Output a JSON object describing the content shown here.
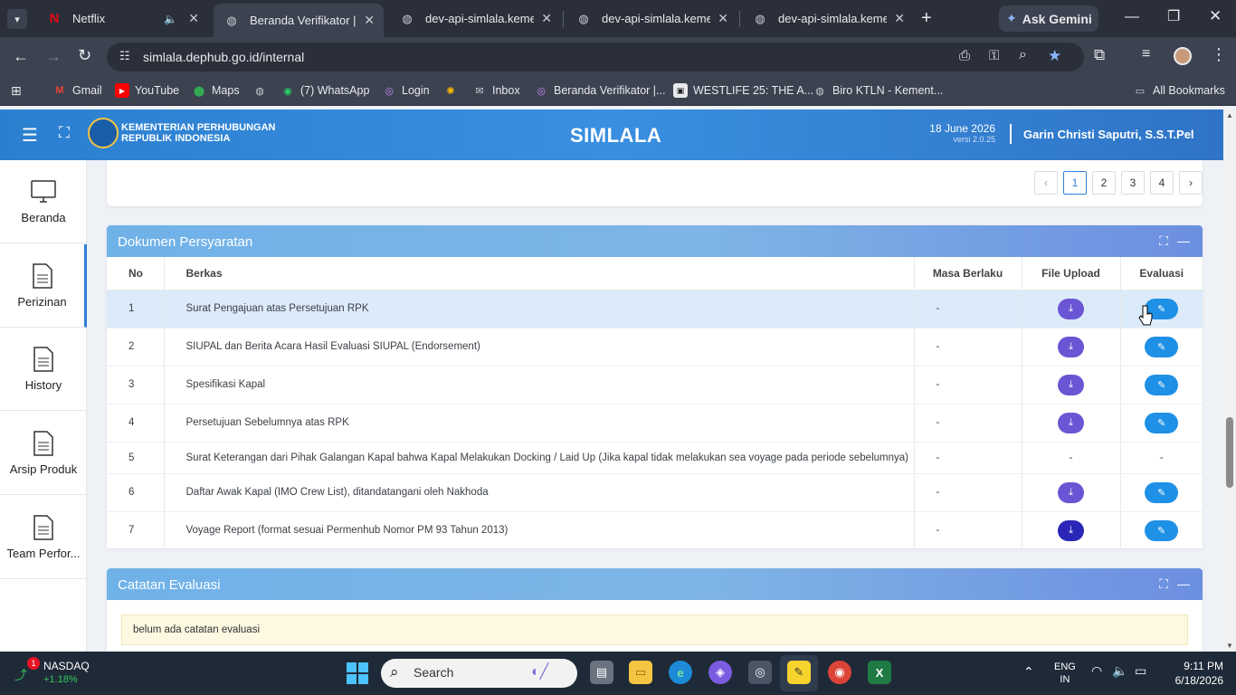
{
  "browser": {
    "tabs": [
      {
        "title": "Netflix",
        "icon": "netflix-icon"
      },
      {
        "title": "Beranda Verifikator | Si",
        "icon": "globe-icon"
      },
      {
        "title": "dev-api-simlala.kemen",
        "icon": "globe-icon"
      },
      {
        "title": "dev-api-simlala.kemen",
        "icon": "globe-icon"
      },
      {
        "title": "dev-api-simlala.kemen",
        "icon": "globe-icon"
      }
    ],
    "gemini_label": "Ask Gemini",
    "url": "simlala.dephub.go.id/internal",
    "bookmarks": [
      "Gmail",
      "YouTube",
      "Maps",
      "(7) WhatsApp",
      "Login",
      "Inbox",
      "Beranda Verifikator |...",
      "WESTLIFE 25: THE A...",
      "Biro KTLN - Kement..."
    ],
    "all_bookmarks": "All Bookmarks"
  },
  "header": {
    "org_line1": "KEMENTERIAN PERHUBUNGAN",
    "org_line2": "REPUBLIK INDONESIA",
    "brand": "SIMLALA",
    "date": "18 June 2026",
    "version": "versi 2.0.25",
    "user": "Garin Christi Saputri, S.S.T.Pel"
  },
  "sidebar": {
    "items": [
      {
        "label": "Beranda"
      },
      {
        "label": "Perizinan"
      },
      {
        "label": "History"
      },
      {
        "label": "Arsip Produk"
      },
      {
        "label": "Team Perfor..."
      }
    ]
  },
  "pagination": {
    "prev": "‹",
    "pages": [
      "1",
      "2",
      "3",
      "4"
    ],
    "next": "›",
    "current": "1"
  },
  "documents": {
    "title": "Dokumen Persyaratan",
    "columns": {
      "no": "No",
      "berkas": "Berkas",
      "masa": "Masa Berlaku",
      "file": "File Upload",
      "evaluasi": "Evaluasi"
    },
    "rows": [
      {
        "no": "1",
        "berkas": "Surat Pengajuan atas Persetujuan RPK",
        "masa": "-"
      },
      {
        "no": "2",
        "berkas": "SIUPAL dan Berita Acara Hasil Evaluasi SIUPAL (Endorsement)",
        "masa": "-"
      },
      {
        "no": "3",
        "berkas": "Spesifikasi Kapal",
        "masa": "-"
      },
      {
        "no": "4",
        "berkas": "Persetujuan Sebelumnya atas RPK",
        "masa": "-"
      },
      {
        "no": "5",
        "berkas": "Surat Keterangan dari Pihak Galangan Kapal bahwa Kapal Melakukan Docking / Laid Up (Jika kapal tidak melakukan sea voyage pada periode sebelumnya)",
        "masa": "-",
        "file": "-",
        "evaluasi": "-"
      },
      {
        "no": "6",
        "berkas": "Daftar Awak Kapal (IMO Crew List), ditandatangani oleh Nakhoda",
        "masa": "-"
      },
      {
        "no": "7",
        "berkas": "Voyage Report (format sesuai Permenhub Nomor PM 93 Tahun 2013)",
        "masa": "-"
      }
    ]
  },
  "evaluation": {
    "title": "Catatan Evaluasi",
    "note": "belum ada catatan evaluasi"
  },
  "taskbar": {
    "stock_name": "NASDAQ",
    "stock_change": "+1.18%",
    "stock_badge": "1",
    "search": "Search",
    "lang1": "ENG",
    "lang2": "IN",
    "time": "9:11 PM",
    "date": "6/18/2026"
  },
  "colors": {
    "header_blue": "#2b7fd0",
    "download_btn": "#6a56d4",
    "evaluate_btn": "#1e90e6",
    "row_highlight": "#dcebfa"
  }
}
